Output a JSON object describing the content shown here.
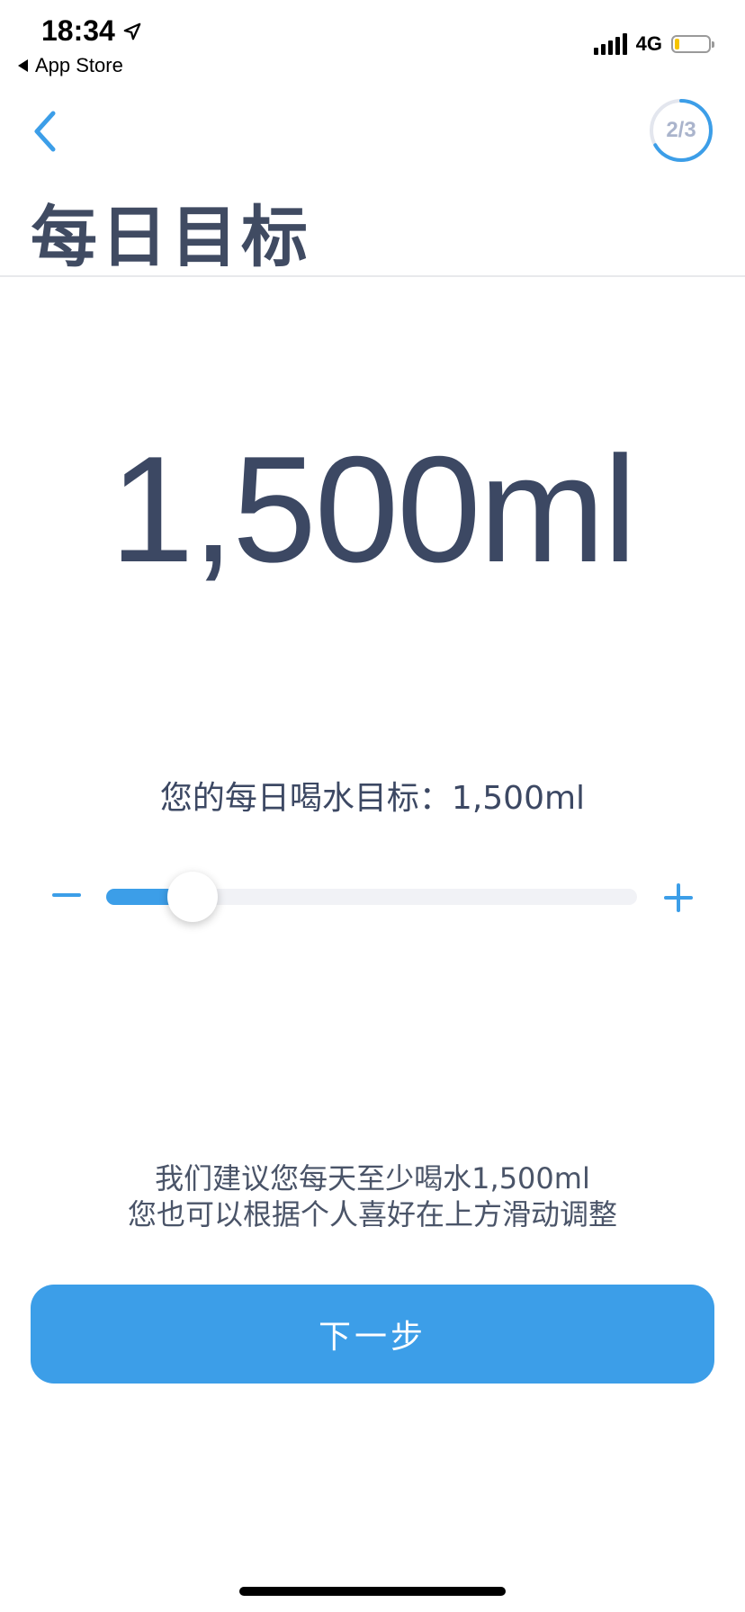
{
  "status_bar": {
    "time": "18:34",
    "back_app": "App Store",
    "network": "4G",
    "battery_level_fraction": 0.15
  },
  "nav": {
    "step": "2/3",
    "step_progress_fraction": 0.667
  },
  "page_title": "每日目标",
  "goal": {
    "big_value": "1,500ml",
    "label_line": "您的每日喝水目标：1,500ml",
    "slider_fraction": 0.145
  },
  "hint": {
    "line1": "我们建议您每天至少喝水1,500ml",
    "line2": "您也可以根据个人喜好在上方滑动调整"
  },
  "next_button": "下一步",
  "colors": {
    "accent": "#3c9ee8",
    "text": "#3c4863"
  }
}
